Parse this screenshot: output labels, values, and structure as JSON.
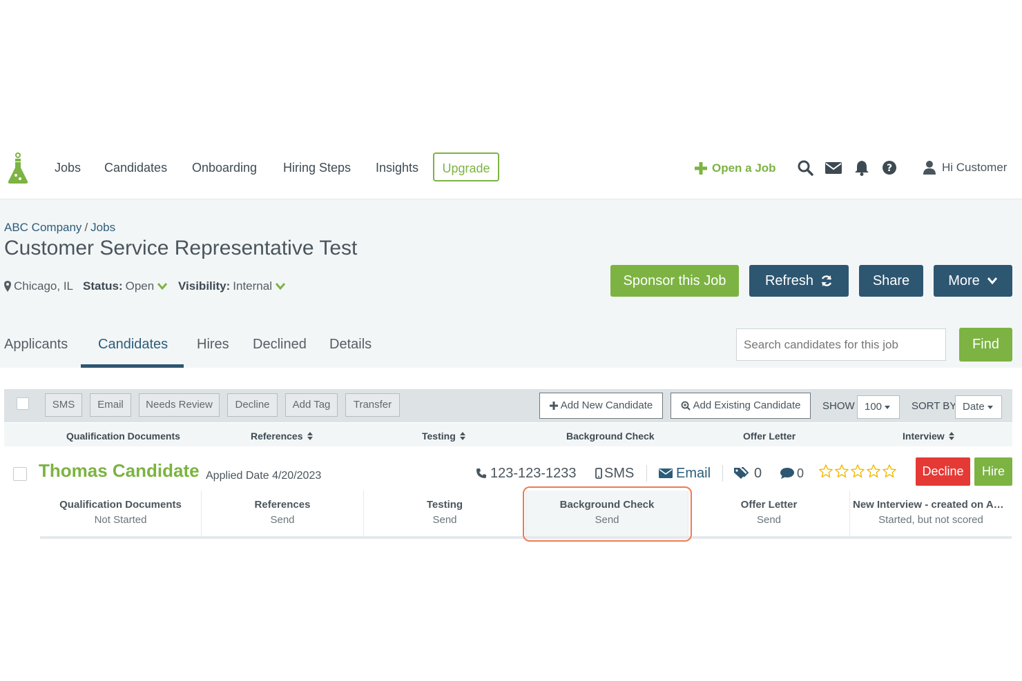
{
  "nav": {
    "items": [
      "Jobs",
      "Candidates",
      "Onboarding",
      "Hiring Steps",
      "Insights"
    ],
    "upgrade": "Upgrade",
    "open_job": "Open a Job",
    "greeting": "Hi Customer",
    "icons": [
      "search-icon",
      "envelope-icon",
      "bell-icon",
      "help-icon",
      "user-icon"
    ]
  },
  "header": {
    "breadcrumb": [
      "ABC Company",
      "Jobs"
    ],
    "title": "Customer Service Representative Test",
    "location": "Chicago, IL",
    "status_label": "Status:",
    "status_value": "Open",
    "visibility_label": "Visibility:",
    "visibility_value": "Internal",
    "buttons": {
      "sponsor": "Sponsor this Job",
      "refresh": "Refresh",
      "share": "Share",
      "more": "More"
    }
  },
  "tabs": [
    "Applicants",
    "Candidates",
    "Hires",
    "Declined",
    "Details"
  ],
  "search": {
    "placeholder": "Search candidates for this job",
    "button": "Find"
  },
  "toolbar": {
    "actions": [
      "SMS",
      "Email",
      "Needs Review",
      "Decline",
      "Add Tag",
      "Transfer"
    ],
    "add_new": "Add New Candidate",
    "add_existing": "Add Existing Candidate",
    "show_label": "SHOW",
    "show_value": "100",
    "sort_label": "SORT BY",
    "sort_value": "Date"
  },
  "columns": [
    "Qualification Documents",
    "References",
    "Testing",
    "Background Check",
    "Offer Letter",
    "Interview"
  ],
  "candidate": {
    "name": "Thomas Candidate",
    "applied": "Applied Date 4/20/2023",
    "phone": "123-123-1233",
    "sms": "SMS",
    "email": "Email",
    "tags": "0",
    "comments": "0",
    "rating": 0,
    "rating_max": 5,
    "decline": "Decline",
    "hire": "Hire",
    "steps": [
      {
        "title": "Qualification Documents",
        "status": "Not Started"
      },
      {
        "title": "References",
        "status": "Send"
      },
      {
        "title": "Testing",
        "status": "Send"
      },
      {
        "title": "Background Check",
        "status": "Send"
      },
      {
        "title": "Offer Letter",
        "status": "Send"
      },
      {
        "title": "New Interview - created on Apr...",
        "status": "Started, but not scored"
      }
    ]
  },
  "colors": {
    "green": "#7cb342",
    "navy": "#2d5671",
    "red": "#e53935",
    "highlight": "#ee7a4f"
  }
}
